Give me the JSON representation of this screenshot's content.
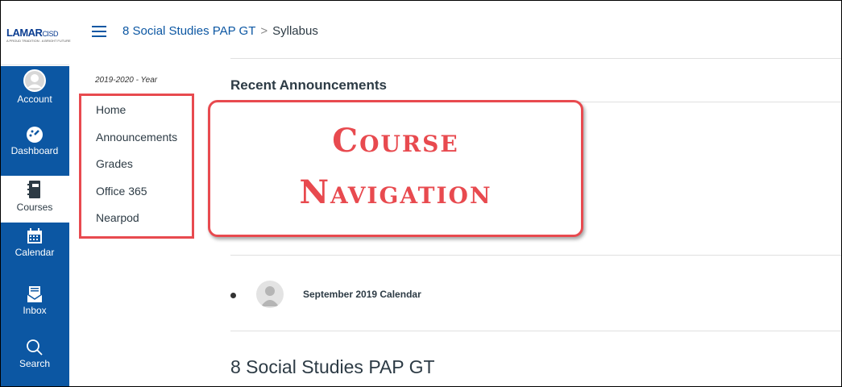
{
  "logo": {
    "main": "LAMAR",
    "suffix": "CISD",
    "tagline": "A PROUD TRADITION . A BRIGHT FUTURE"
  },
  "global_nav": [
    {
      "label": "Account",
      "icon": "account-icon"
    },
    {
      "label": "Dashboard",
      "icon": "dashboard-icon"
    },
    {
      "label": "Courses",
      "icon": "courses-icon",
      "active": true
    },
    {
      "label": "Calendar",
      "icon": "calendar-icon"
    },
    {
      "label": "Inbox",
      "icon": "inbox-icon"
    },
    {
      "label": "Search",
      "icon": "search-icon"
    }
  ],
  "breadcrumb": {
    "course": "8 Social Studies PAP GT",
    "separator": ">",
    "page": "Syllabus"
  },
  "course_nav": {
    "term": "2019-2020 - Year",
    "items": [
      "Home",
      "Announcements",
      "Grades",
      "Office 365",
      "Nearpod"
    ]
  },
  "callout": {
    "line1": "Course",
    "line2": "Navigation"
  },
  "main": {
    "recent_heading": "Recent Announcements",
    "announcements": [
      {
        "title": "September 2019 Calendar"
      }
    ],
    "course_title": "8 Social Studies PAP GT"
  },
  "colors": {
    "brand_blue": "#0c57a3",
    "callout_red": "#e84a4f",
    "text": "#2d3b45"
  }
}
